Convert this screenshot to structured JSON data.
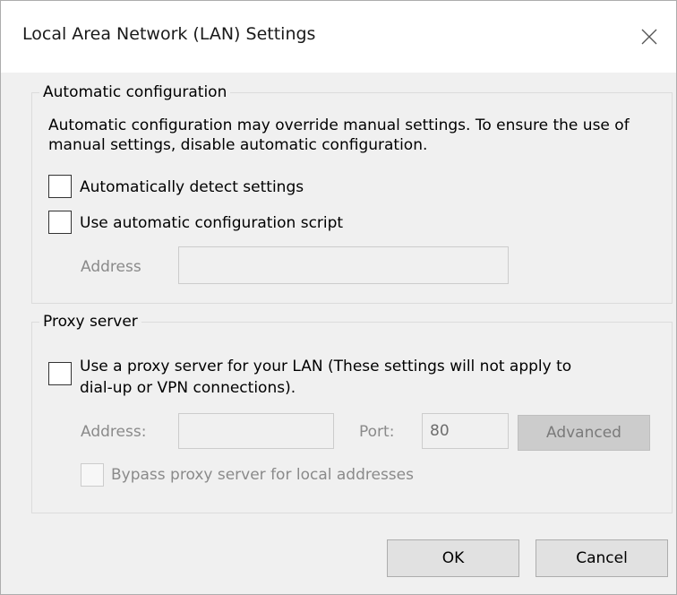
{
  "window": {
    "title": "Local Area Network (LAN) Settings"
  },
  "automatic_configuration": {
    "legend": "Automatic configuration",
    "description": "Automatic configuration may override manual settings.  To ensure the use of manual settings, disable automatic configuration.",
    "detect_settings": {
      "label": "Automatically detect settings",
      "checked": false
    },
    "use_script": {
      "label": "Use automatic configuration script",
      "checked": false
    },
    "address_label": "Address",
    "address_value": ""
  },
  "proxy_server": {
    "legend": "Proxy server",
    "use_proxy": {
      "label_line1": "Use a proxy server for your LAN (These settings will not apply to",
      "label_line2": "dial-up or VPN connections).",
      "checked": false
    },
    "address_label": "Address:",
    "address_value": "",
    "port_label": "Port:",
    "port_value": "80",
    "advanced_label": "Advanced",
    "bypass": {
      "label": "Bypass proxy server for local addresses",
      "checked": false
    }
  },
  "buttons": {
    "ok": "OK",
    "cancel": "Cancel"
  }
}
